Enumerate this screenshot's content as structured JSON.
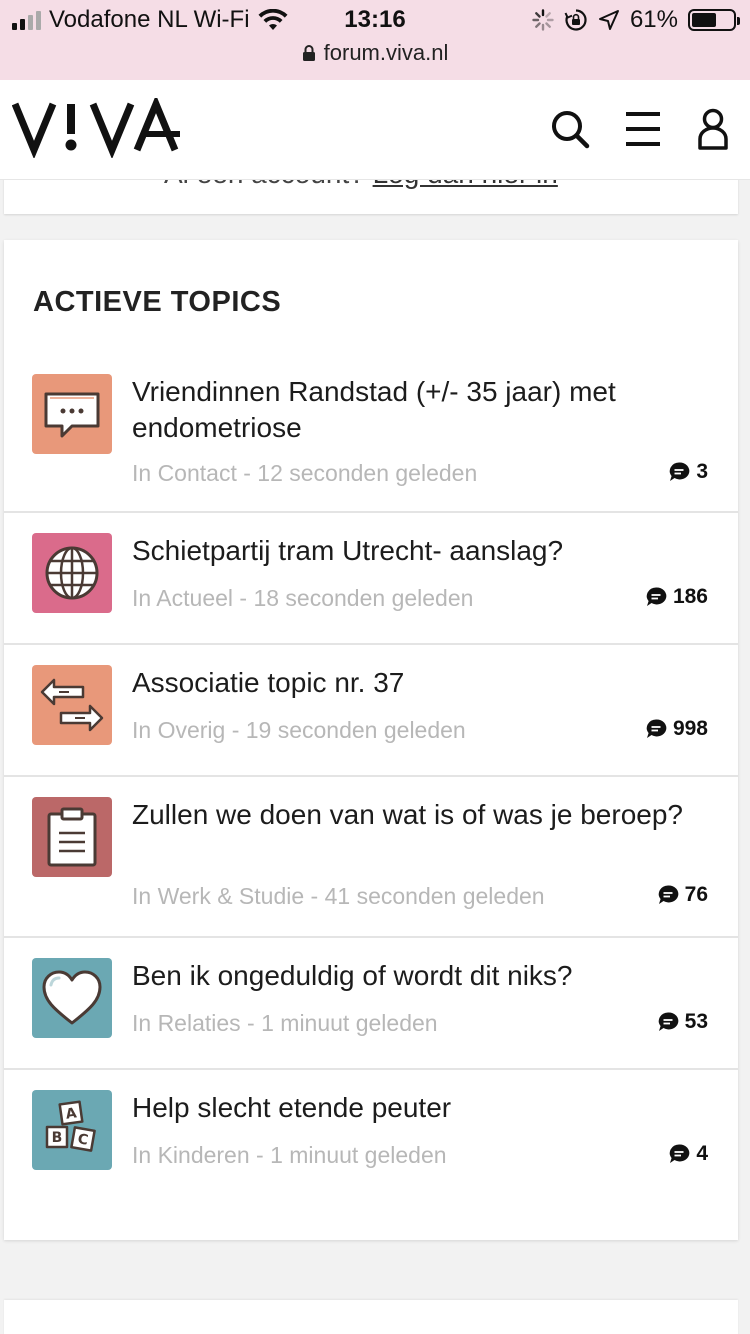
{
  "status": {
    "carrier": "Vodafone NL Wi-Fi",
    "time": "13:16",
    "battery": "61%",
    "battery_level": 0.61,
    "url": "forum.viva.nl"
  },
  "header": {
    "logo": "VIVA",
    "icons": [
      "search-icon",
      "menu-icon",
      "user-icon"
    ]
  },
  "account_prompt": {
    "text": "Al een account?",
    "link": "Log dan hier in"
  },
  "section": {
    "title": "ACTIEVE TOPICS",
    "topics": [
      {
        "title": "Vriendinnen Randstad (+/- 35 jaar) met endometriose",
        "meta": "In Contact - 12 seconden geleden",
        "count": "3",
        "icon": "chat-bubble-icon",
        "color": "#e8987a"
      },
      {
        "title": "Schietpartij tram Utrecht- aanslag?",
        "meta": "In Actueel - 18 seconden geleden",
        "count": "186",
        "icon": "globe-icon",
        "color": "#da6b8b"
      },
      {
        "title": "Associatie topic nr. 37",
        "meta": "In Overig - 19 seconden geleden",
        "count": "998",
        "icon": "arrows-icon",
        "color": "#e8987a"
      },
      {
        "title": "Zullen we doen van wat is of was je beroep?",
        "meta": "In Werk & Studie - 41 seconden geleden",
        "count": "76",
        "icon": "clipboard-icon",
        "color": "#bb6868"
      },
      {
        "title": "Ben ik ongeduldig of wordt dit niks?",
        "meta": "In Relaties - 1 minuut geleden",
        "count": "53",
        "icon": "heart-icon",
        "color": "#6ba8b3"
      },
      {
        "title": "Help slecht etende peuter",
        "meta": "In Kinderen - 1 minuut geleden",
        "count": "4",
        "icon": "blocks-icon",
        "color": "#6ba8b3"
      }
    ]
  },
  "block_letters": [
    "A",
    "B",
    "C"
  ]
}
